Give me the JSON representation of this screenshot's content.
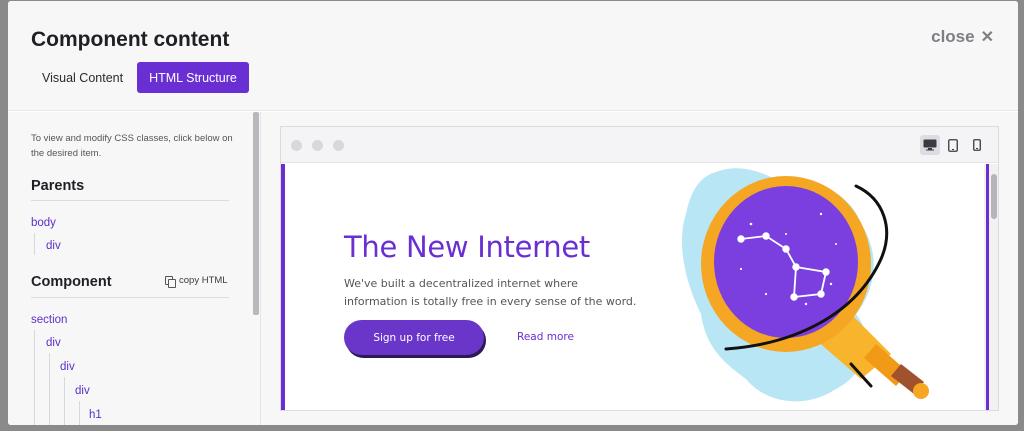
{
  "modal": {
    "title": "Component content",
    "close_label": "close",
    "tabs": [
      {
        "label": "Visual Content",
        "active": false
      },
      {
        "label": "HTML Structure",
        "active": true
      }
    ]
  },
  "sidebar": {
    "hint": "To view and modify CSS classes, click below on the desired item.",
    "parents_title": "Parents",
    "parents": [
      "body",
      "div"
    ],
    "component_title": "Component",
    "copy_html_label": "copy HTML",
    "component_tree": [
      "section",
      "div",
      "div",
      "div",
      "h1"
    ]
  },
  "preview": {
    "devices": [
      {
        "icon": "desktop-icon",
        "active": true
      },
      {
        "icon": "tablet-icon",
        "active": false
      },
      {
        "icon": "mobile-icon",
        "active": false
      }
    ],
    "hero": {
      "title": "The New Internet",
      "text": "We've built a decentralized internet where information is totally free in every sense of the word.",
      "primary_button": "Sign up for free",
      "secondary_link": "Read more"
    }
  },
  "colors": {
    "accent": "#6a2fd3",
    "button": "#6a35c9",
    "illustration_purple": "#7b3fe0",
    "illustration_orange": "#f5a623",
    "illustration_blue": "#b9e6f5"
  }
}
